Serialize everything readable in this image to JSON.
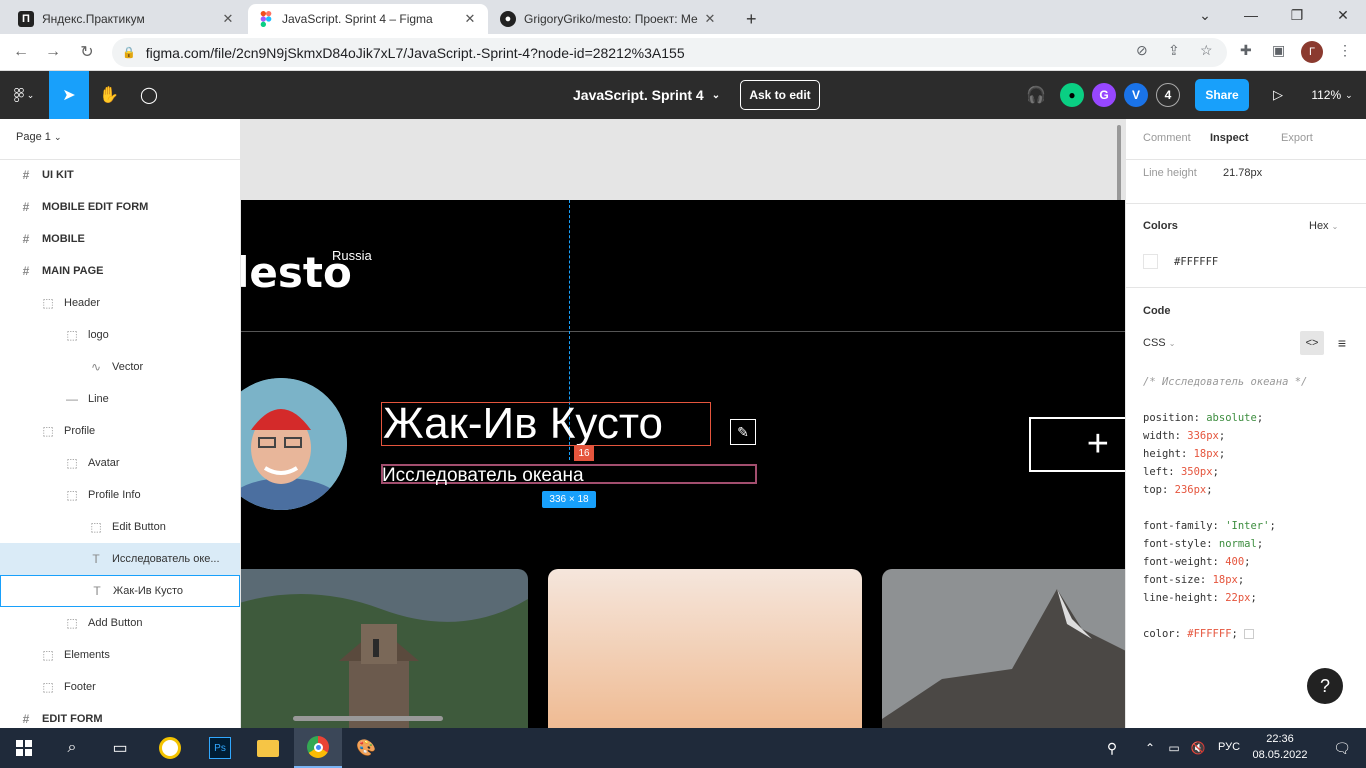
{
  "browser": {
    "tabs": [
      {
        "label": "Яндекс.Практикум",
        "favicon": "yandex-icon"
      },
      {
        "label": "JavaScript. Sprint 4 – Figma",
        "favicon": "figma-icon"
      },
      {
        "label": "GrigoryGriko/mesto: Проект: Ме",
        "favicon": "github-icon"
      }
    ],
    "new_tab": "+",
    "url": "figma.com/file/2cn9N9jSkmxD84oJik7xL7/JavaScript.-Sprint-4?node-id=28212%3A155",
    "profile_letter": "Г"
  },
  "figma": {
    "doc_name": "JavaScript. Sprint 4",
    "ask_to_edit": "Ask to edit",
    "collab_count": "4",
    "avatars": [
      "G",
      "V"
    ],
    "share": "Share",
    "zoom": "112%",
    "page": "Page 1"
  },
  "layers": [
    {
      "label": "UI KIT",
      "glyph": "#"
    },
    {
      "label": "MOBILE EDIT FORM",
      "glyph": "#"
    },
    {
      "label": "MOBILE",
      "glyph": "#"
    },
    {
      "label": "MAIN PAGE",
      "glyph": "#"
    },
    {
      "label": "Header",
      "glyph": "⬚"
    },
    {
      "label": "logo",
      "glyph": "⬚"
    },
    {
      "label": "Vector",
      "glyph": "∿"
    },
    {
      "label": "Line",
      "glyph": "—"
    },
    {
      "label": "Profile",
      "glyph": "⬚"
    },
    {
      "label": "Avatar",
      "glyph": "⬚"
    },
    {
      "label": "Profile Info",
      "glyph": "⬚"
    },
    {
      "label": "Edit Button",
      "glyph": "⬚"
    },
    {
      "label": "Исследователь оке...",
      "glyph": "T"
    },
    {
      "label": "Жак-Ив Кусто",
      "glyph": "T"
    },
    {
      "label": "Add Button",
      "glyph": "⬚"
    },
    {
      "label": "Elements",
      "glyph": "⬚"
    },
    {
      "label": "Footer",
      "glyph": "⬚"
    },
    {
      "label": "EDIT FORM",
      "glyph": "#"
    }
  ],
  "canvas": {
    "logo_text": "lesto",
    "logo_sup": "Russia",
    "name": "Жак-Ив Кусто",
    "about": "Исследователь океана",
    "spacing_badge": "16",
    "size_badge": "336 × 18",
    "add_symbol": "+"
  },
  "inspect": {
    "tabs": [
      "Comment",
      "Inspect",
      "Export"
    ],
    "line_height_label": "Line height",
    "line_height_value": "21.78px",
    "colors_title": "Colors",
    "color_format": "Hex",
    "color_value": "#FFFFFF",
    "code_title": "Code",
    "code_lang": "CSS",
    "comment": "/* Исследователь океана */",
    "props": [
      {
        "k": "position",
        "v": "absolute",
        "c": "g"
      },
      {
        "k": "width",
        "v": "336px",
        "c": "r"
      },
      {
        "k": "height",
        "v": "18px",
        "c": "r"
      },
      {
        "k": "left",
        "v": "350px",
        "c": "r"
      },
      {
        "k": "top",
        "v": "236px",
        "c": "r"
      },
      {
        "k": "",
        "v": "",
        "c": ""
      },
      {
        "k": "font-family",
        "v": "'Inter'",
        "c": "g"
      },
      {
        "k": "font-style",
        "v": "normal",
        "c": "g"
      },
      {
        "k": "font-weight",
        "v": "400",
        "c": "r"
      },
      {
        "k": "font-size",
        "v": "18px",
        "c": "r"
      },
      {
        "k": "line-height",
        "v": "22px",
        "c": "r"
      },
      {
        "k": "",
        "v": "",
        "c": ""
      },
      {
        "k": "color",
        "v": "#FFFFFF",
        "c": "r"
      }
    ]
  },
  "taskbar": {
    "lang": "РУС",
    "time": "22:36",
    "date": "08.05.2022"
  },
  "colors": {
    "accent": "#18a0fb",
    "figma_bar": "#2c2c2c",
    "selection": "#daebf7"
  }
}
